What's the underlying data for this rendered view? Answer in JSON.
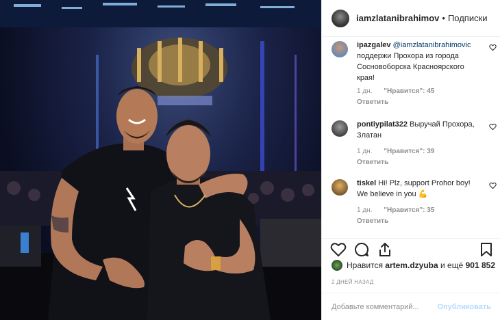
{
  "post": {
    "author": "iamzlatanibrahimov",
    "separator": "•",
    "follow_label": "Подписки"
  },
  "comments": [
    {
      "user": "ipazgalev",
      "mention": "@iamzlatanibrahimovic",
      "text": "поддержи Прохора из города Сосновоборска Красноярского края!",
      "age": "1 дн.",
      "likes": "\"Нравится\": 45",
      "reply_label": "Ответить"
    },
    {
      "user": "pontiypilat322",
      "mention": "",
      "text": "Выручай Прохора, Златан",
      "age": "1 дн.",
      "likes": "\"Нравится\": 39",
      "reply_label": "Ответить"
    },
    {
      "user": "tiskel",
      "mention": "",
      "text": "Hi! Plz, support Prohor boy! We believe in you 💪",
      "age": "1 дн.",
      "likes": "\"Нравится\": 35",
      "reply_label": "Ответить"
    }
  ],
  "likes_summary": {
    "prefix": "Нравится",
    "user": "artem.dzyuba",
    "middle": "и ещё",
    "count": "901 852"
  },
  "time_ago": "2 ДНЕЙ НАЗАД",
  "add_comment": {
    "placeholder": "Добавьте комментарий...",
    "publish_label": "Опубликовать"
  },
  "colors": {
    "link": "#00376b",
    "muted": "#8e8e8e",
    "publish_disabled": "#b3dbff"
  }
}
